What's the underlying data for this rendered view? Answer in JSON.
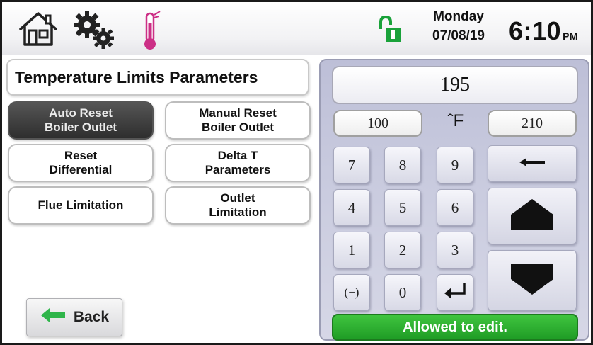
{
  "header": {
    "icons": [
      "home-icon",
      "gear-icon",
      "thermometer-icon",
      "lock-open-icon"
    ],
    "day": "Monday",
    "date": "07/08/19",
    "time": "6:10",
    "ampm": "PM",
    "lock_color": "#1aa23a",
    "thermometer_color": "#cc2f86"
  },
  "panel": {
    "title": "Temperature Limits Parameters",
    "buttons": [
      {
        "label": "Auto Reset\nBoiler Outlet",
        "active": true
      },
      {
        "label": "Manual Reset\nBoiler Outlet",
        "active": false
      },
      {
        "label": "Reset\nDifferential",
        "active": false
      },
      {
        "label": "Delta T\nParameters",
        "active": false
      },
      {
        "label": "Flue Limitation",
        "active": false
      },
      {
        "label": "Outlet\nLimitation",
        "active": false
      }
    ],
    "back_label": "Back"
  },
  "keypad": {
    "value": "195",
    "min": "100",
    "max": "210",
    "unit": "ˆF",
    "keys": [
      "7",
      "8",
      "9",
      "4",
      "5",
      "6",
      "1",
      "2",
      "3",
      "(−)",
      "0"
    ],
    "status": "Allowed to edit.",
    "status_color": "#2ab02f"
  }
}
